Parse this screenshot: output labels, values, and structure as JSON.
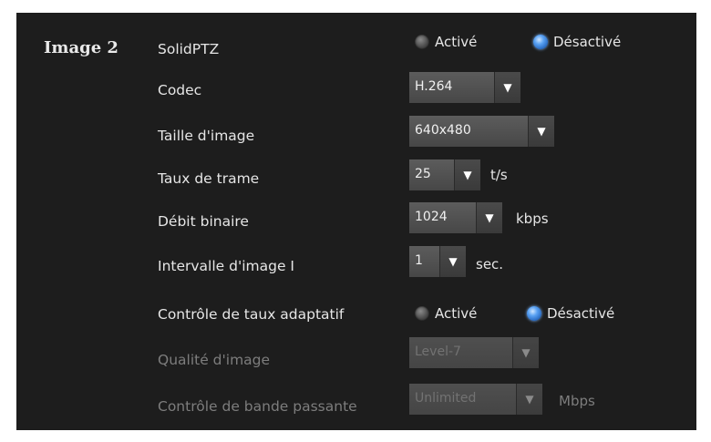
{
  "section": {
    "title": "Image 2"
  },
  "rows": {
    "solidptz": {
      "label": "SolidPTZ",
      "on_label": "Activé",
      "off_label": "Désactivé",
      "selected": "off"
    },
    "codec": {
      "label": "Codec",
      "value": "H.264"
    },
    "image_size": {
      "label": "Taille d'image",
      "value": "640x480"
    },
    "frame_rate": {
      "label": "Taux de trame",
      "value": "25",
      "unit": "t/s"
    },
    "bitrate": {
      "label": "Débit binaire",
      "value": "1024",
      "unit": "kbps"
    },
    "i_interval": {
      "label": "Intervalle d'image I",
      "value": "1",
      "unit": "sec."
    },
    "adaptive": {
      "label": "Contrôle de taux adaptatif",
      "on_label": "Activé",
      "off_label": "Désactivé",
      "selected": "off"
    },
    "quality": {
      "label": "Qualité d'image",
      "value": "Level-7"
    },
    "bandwidth": {
      "label": "Contrôle de bande passante",
      "value": "Unlimited",
      "unit": "Mbps"
    }
  },
  "icons": {
    "dropdown": "triangle-down-icon",
    "dropdown_glyph": "▼"
  },
  "colors": {
    "background": "#1d1d1d",
    "radio_selected": "#4a90e2",
    "text": "#e6e6e6",
    "disabled_text": "#7d7d7d"
  }
}
